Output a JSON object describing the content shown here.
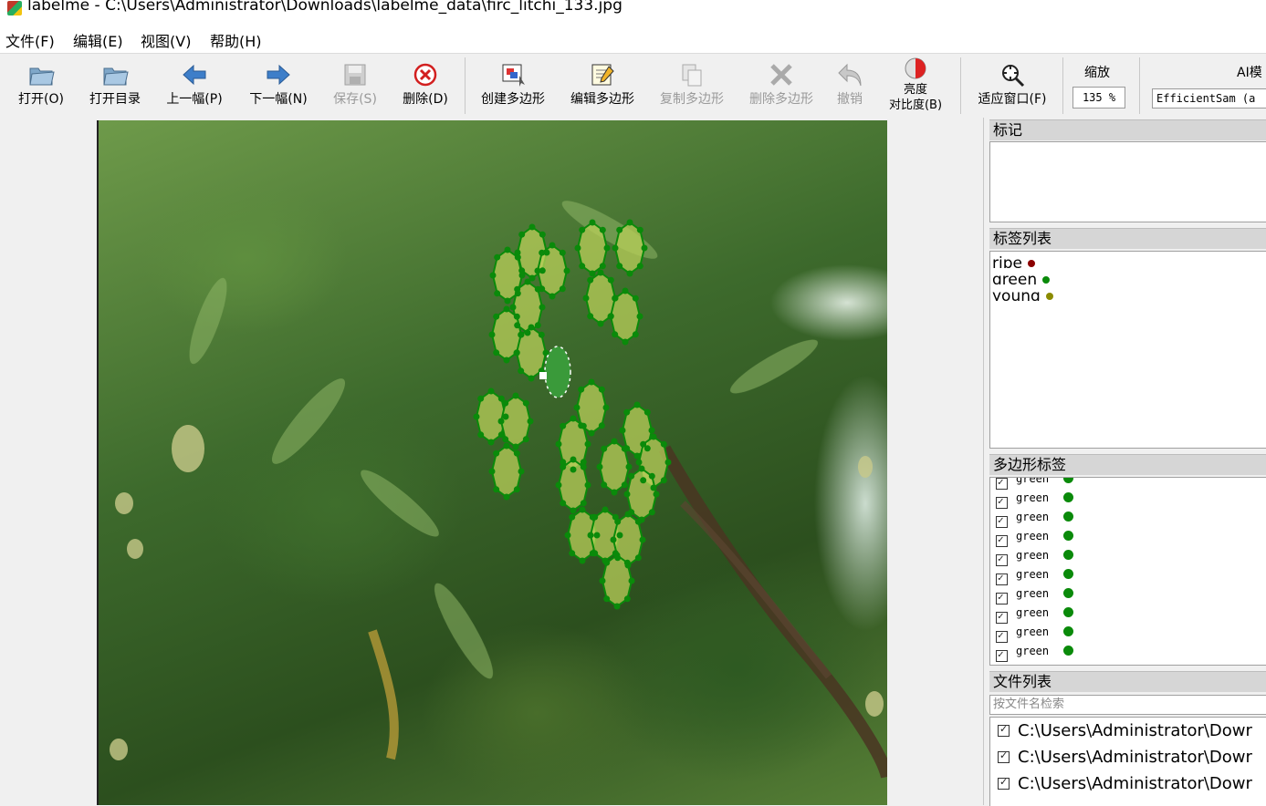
{
  "window": {
    "title": "labelme - C:\\Users\\Administrator\\Downloads\\labelme_data\\firc_litchi_133.jpg",
    "icon": "labelme-app-icon"
  },
  "menu": [
    "文件(F)",
    "编辑(E)",
    "视图(V)",
    "帮助(H)"
  ],
  "toolbar": {
    "open": "打开(O)",
    "open_dir": "打开目录",
    "prev": "上一幅(P)",
    "next": "下一幅(N)",
    "save": "保存(S)",
    "delete": "删除(D)",
    "create_polygon": "创建多边形",
    "edit_polygon": "编辑多边形",
    "copy_polygon": "复制多边形",
    "delete_polygon": "删除多边形",
    "undo": "撤销",
    "brightness_line1": "亮度",
    "brightness_line2": "对比度(B)",
    "fit_window": "适应窗口(F)",
    "zoom_label": "缩放",
    "zoom_value": "135 %",
    "ai_label": "AI模",
    "ai_model": "EfficientSam (a"
  },
  "panels": {
    "flags_title": "标记",
    "labels_title": "标签列表",
    "labels": [
      {
        "name": "ripe",
        "color": "#8b0000"
      },
      {
        "name": "green",
        "color": "#0a8a0a"
      },
      {
        "name": "young",
        "color": "#8b8b00"
      }
    ],
    "polygons_title": "多边形标签",
    "polygons": [
      "green",
      "green",
      "green",
      "green",
      "green",
      "green",
      "green",
      "green",
      "green",
      "green"
    ],
    "files_title": "文件列表",
    "file_search_placeholder": "按文件名检索",
    "files": [
      "C:\\Users\\Administrator\\Dowr",
      "C:\\Users\\Administrator\\Dowr",
      "C:\\Users\\Administrator\\Dowr"
    ]
  },
  "colors": {
    "polygon_fill": "#9acd32",
    "polygon_stroke": "#0a8a0a",
    "vertex": "#0a8a0a"
  }
}
